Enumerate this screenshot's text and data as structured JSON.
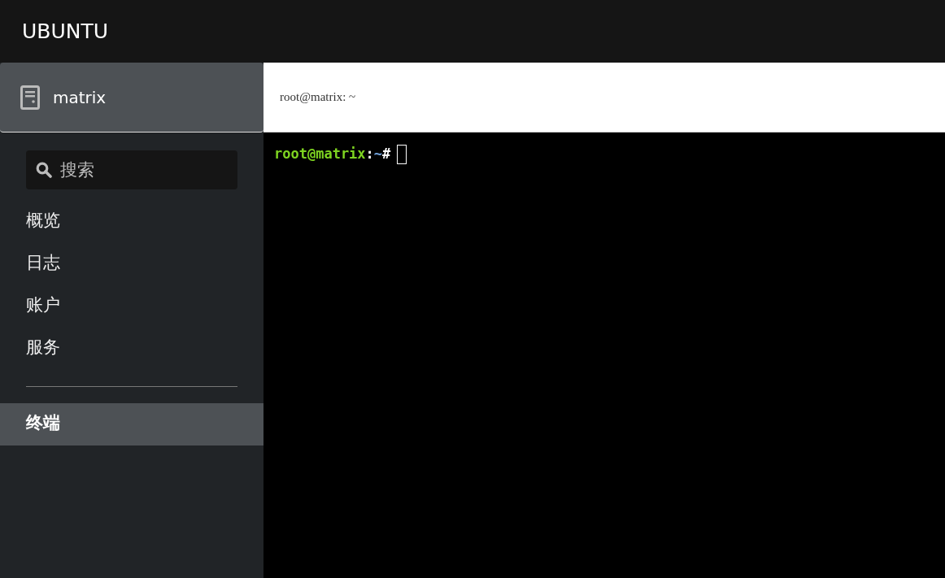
{
  "brand": "UBUNTU",
  "host": {
    "name": "matrix",
    "selected": true
  },
  "search": {
    "placeholder": "搜索"
  },
  "nav_groups": [
    [
      {
        "label": "概览",
        "selected": false
      },
      {
        "label": "日志",
        "selected": false
      },
      {
        "label": "账户",
        "selected": false
      },
      {
        "label": "服务",
        "selected": false
      }
    ],
    [
      {
        "label": "终端",
        "selected": true
      }
    ]
  ],
  "terminal": {
    "title": "root@matrix: ~",
    "prompt": [
      {
        "kind": "user",
        "text": "root@matrix"
      },
      {
        "kind": "sep",
        "text": ":"
      },
      {
        "kind": "path",
        "text": "~"
      },
      {
        "kind": "sep",
        "text": "#"
      }
    ]
  }
}
